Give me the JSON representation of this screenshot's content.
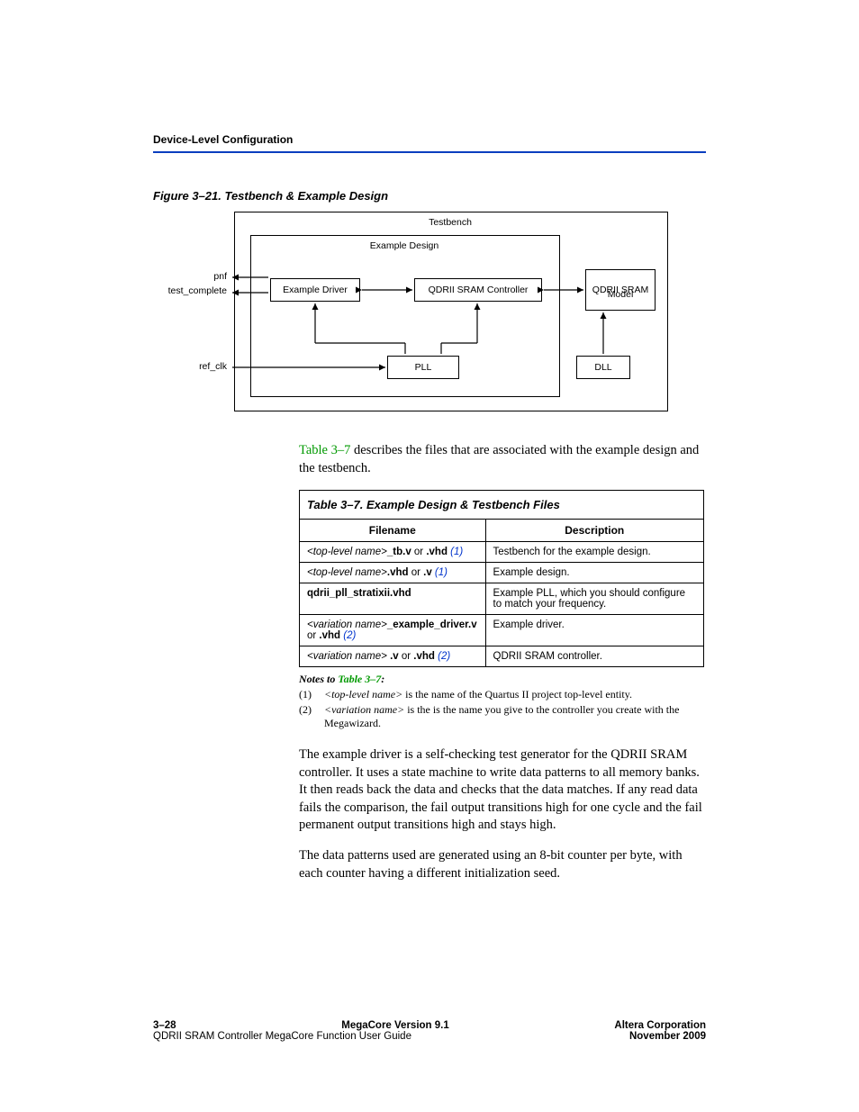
{
  "header": {
    "section": "Device-Level Configuration"
  },
  "figure": {
    "caption": "Figure 3–21. Testbench & Example Design",
    "labels": {
      "testbench": "Testbench",
      "example_design": "Example Design",
      "driver": "Example Driver",
      "controller": "QDRII SRAM Controller",
      "model_l1": "QDRII SRAM",
      "model_l2": "Model",
      "pll": "PLL",
      "dll": "DLL",
      "pnf": "pnf",
      "test_complete": "test_complete",
      "ref_clk": "ref_clk"
    }
  },
  "intro": {
    "link": "Table 3–7",
    "rest": " describes the files that are associated with the example design and the testbench."
  },
  "table": {
    "title": "Table 3–7. Example Design & Testbench Files",
    "col1": "Filename",
    "col2": "Description",
    "rows": [
      {
        "file_pre_i": "<top-level name>",
        "file_mid_b": "_tb.v",
        "file_or": " or ",
        "file_end_b": ".vhd",
        "note_ref": " (1)",
        "desc": "Testbench for the example design."
      },
      {
        "file_pre_i": "<top-level name>",
        "file_mid_b": ".vhd",
        "file_or": " or ",
        "file_end_b": ".v",
        "note_ref": " (1)",
        "desc": "Example design."
      },
      {
        "file_pre_i": "",
        "file_mid_b": "qdrii_pll_stratixii.vhd",
        "file_or": "",
        "file_end_b": "",
        "note_ref": "",
        "desc": "Example PLL, which you should configure to match your frequency."
      },
      {
        "file_pre_i": "<variation name>",
        "file_mid_b": "_example_driver.v",
        "file_or": " or ",
        "file_end_b": ".vhd",
        "note_ref": " (2)",
        "desc": "Example driver."
      },
      {
        "file_pre_i": "<variation name>",
        "file_mid_b": " .v",
        "file_or": " or ",
        "file_end_b": ".vhd",
        "note_ref": " (2)",
        "desc": "QDRII SRAM controller."
      }
    ]
  },
  "notes": {
    "title_pre": "Notes to ",
    "title_link": "Table 3–7",
    "title_post": ":",
    "items": [
      {
        "num": "(1)",
        "pre_i": "<top-level name>",
        "rest": " is the name of the Quartus II project top-level entity."
      },
      {
        "num": "(2)",
        "pre_i": "<variation name>",
        "rest": " is the is the name you give to the controller you create with the Megawizard."
      }
    ]
  },
  "para1": "The example driver is a self-checking test generator for the QDRII SRAM controller. It uses a state machine to write data patterns to all memory banks. It then reads back the data and checks that the data matches. If any read data fails the comparison, the fail output transitions high for one cycle and the fail permanent output transitions high and stays high.",
  "para2": "The data patterns used are generated using an 8-bit counter per byte, with each counter having a different initialization seed.",
  "footer": {
    "page": "3–28",
    "version": "MegaCore Version 9.1",
    "corp": "Altera Corporation",
    "guide": "QDRII SRAM Controller MegaCore Function User Guide",
    "date": "November 2009"
  }
}
